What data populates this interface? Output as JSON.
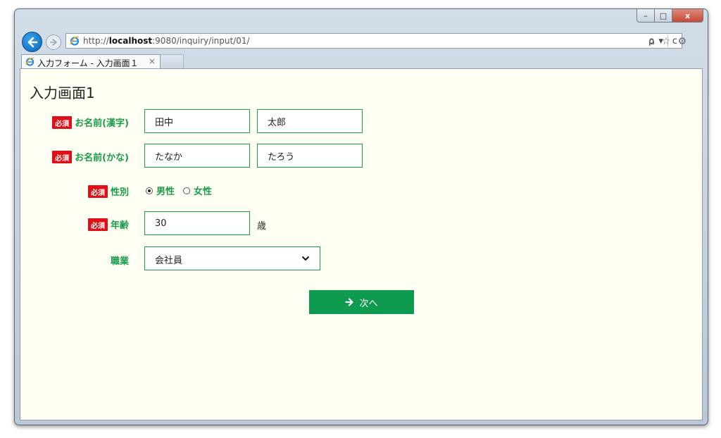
{
  "browser": {
    "url_prefix": "http://",
    "url_host": "localhost",
    "url_rest": ":9080/inquiry/input/01/",
    "tab_title": "入力フォーム - 入力画面１",
    "tab_close": "×",
    "caption": {
      "minimize": "–",
      "maximize": "□",
      "close": "x"
    },
    "addr_tools": {
      "search": "ρ",
      "dropdown": "▾",
      "refresh": "c"
    }
  },
  "page": {
    "title": "入力画面1",
    "required_badge": "必須",
    "name_kanji": {
      "label": "お名前(漢字)",
      "last": "田中",
      "first": "太郎"
    },
    "name_kana": {
      "label": "お名前(かな)",
      "last": "たなか",
      "first": "たろう"
    },
    "gender": {
      "label": "性別",
      "options": [
        "男性",
        "女性"
      ],
      "selected": "男性"
    },
    "age": {
      "label": "年齢",
      "value": "30",
      "unit": "歳"
    },
    "job": {
      "label": "職業",
      "value": "会社員"
    },
    "next_button": "次へ"
  },
  "colors": {
    "accent": "#1a9c4a",
    "button": "#0f9b4f",
    "required": "#e00f17",
    "page_bg": "#fffff4"
  }
}
